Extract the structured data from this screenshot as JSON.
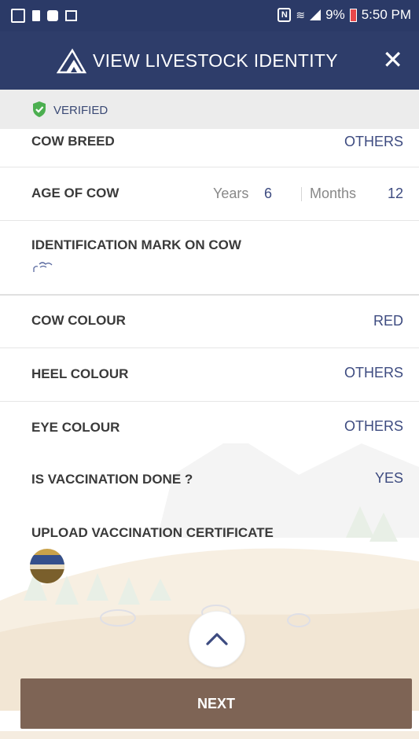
{
  "status_bar": {
    "time": "5:50 PM",
    "battery": "9%",
    "icons": [
      "cast-icon",
      "sim-icon",
      "bag-icon",
      "image-icon",
      "nfc-icon",
      "wifi-icon",
      "signal-icon",
      "battery-icon"
    ]
  },
  "header": {
    "title": "VIEW LIVESTOCK IDENTITY",
    "close_label": "✕",
    "background": "#2e3d6a"
  },
  "verified": {
    "label": "VERIFIED",
    "color": "#4caf50"
  },
  "details": {
    "cow_breed": {
      "label": "COW BREED",
      "value": "OTHERS"
    },
    "age_of_cow": {
      "label": "AGE OF COW",
      "years_label": "Years",
      "years_value": "6",
      "months_label": "Months",
      "months_value": "12"
    },
    "identification_mark": {
      "label": "IDENTIFICATION MARK ON COW"
    },
    "cow_colour": {
      "label": "COW COLOUR",
      "value": "RED"
    },
    "heel_colour": {
      "label": "HEEL COLOUR",
      "value": "OTHERS"
    },
    "eye_colour": {
      "label": "EYE COLOUR",
      "value": "OTHERS"
    },
    "vaccination": {
      "label": "IS VACCINATION DONE ?",
      "value": "YES"
    },
    "upload_certificate": {
      "label": "UPLOAD VACCINATION CERTIFICATE"
    }
  },
  "actions": {
    "next_label": "NEXT",
    "next_color": "#7e6455"
  },
  "colors": {
    "value_text": "#3d4b80",
    "label_text": "#3a3a3a"
  }
}
